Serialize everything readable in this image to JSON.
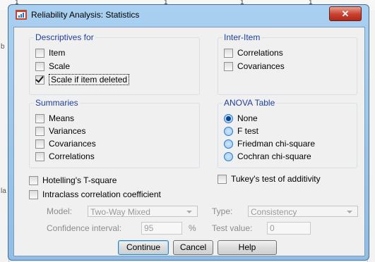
{
  "dialog": {
    "title": "Reliability Analysis: Statistics",
    "close_glyph": "✕"
  },
  "background": {
    "tick_labels": [
      "1",
      "1",
      "1",
      "1"
    ],
    "left_labels": [
      "b",
      "la"
    ]
  },
  "descriptives": {
    "legend": "Descriptives for",
    "items": [
      {
        "label": "Item",
        "checked": false
      },
      {
        "label": "Scale",
        "checked": false
      },
      {
        "label": "Scale if item deleted",
        "checked": true
      }
    ]
  },
  "inter_item": {
    "legend": "Inter-Item",
    "items": [
      {
        "label": "Correlations",
        "checked": false
      },
      {
        "label": "Covariances",
        "checked": false
      }
    ]
  },
  "summaries": {
    "legend": "Summaries",
    "items": [
      {
        "label": "Means",
        "checked": false
      },
      {
        "label": "Variances",
        "checked": false
      },
      {
        "label": "Covariances",
        "checked": false
      },
      {
        "label": "Correlations",
        "checked": false
      }
    ]
  },
  "anova": {
    "legend": "ANOVA Table",
    "options": [
      {
        "label": "None",
        "selected": true
      },
      {
        "label": "F test",
        "selected": false
      },
      {
        "label": "Friedman chi-square",
        "selected": false
      },
      {
        "label": "Cochran chi-square",
        "selected": false
      }
    ]
  },
  "extras": {
    "hotelling": "Hotelling's T-square",
    "tukey": "Tukey's test of additivity",
    "intraclass": "Intraclass correlation coefficient"
  },
  "icc": {
    "model_label": "Model:",
    "model_value": "Two-Way Mixed",
    "type_label": "Type:",
    "type_value": "Consistency",
    "ci_label": "Confidence interval:",
    "ci_value": "95",
    "ci_unit": "%",
    "test_label": "Test value:",
    "test_value": "0"
  },
  "buttons": {
    "continue": "Continue",
    "cancel": "Cancel",
    "help": "Help"
  },
  "colors": {
    "title_bar": "#a9d0f0",
    "legend_text": "#1f3f9a",
    "close_button": "#c8402e"
  }
}
